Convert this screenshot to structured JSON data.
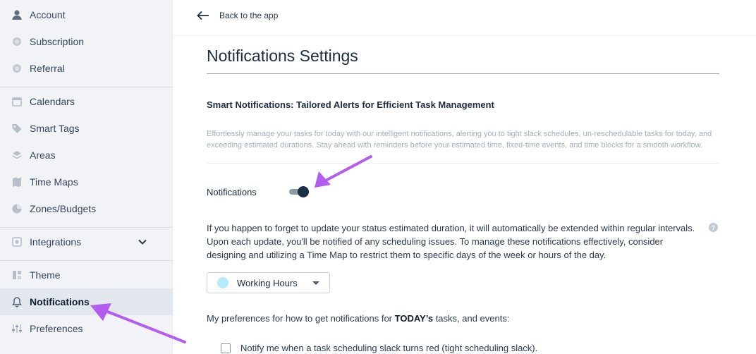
{
  "sidebar": {
    "items": [
      {
        "label": "Account",
        "icon": "user-icon"
      },
      {
        "label": "Subscription",
        "icon": "gear-icon"
      },
      {
        "label": "Referral",
        "icon": "gear-icon"
      },
      {
        "label": "Calendars",
        "icon": "calendar-icon"
      },
      {
        "label": "Smart Tags",
        "icon": "tag-icon"
      },
      {
        "label": "Areas",
        "icon": "layers-icon"
      },
      {
        "label": "Time Maps",
        "icon": "map-icon"
      },
      {
        "label": "Zones/Budgets",
        "icon": "pie-chart-icon"
      },
      {
        "label": "Integrations",
        "icon": "integration-icon"
      },
      {
        "label": "Theme",
        "icon": "theme-icon"
      },
      {
        "label": "Notifications",
        "icon": "bell-icon",
        "active": true
      },
      {
        "label": "Preferences",
        "icon": "sliders-icon"
      }
    ]
  },
  "topbar": {
    "back_label": "Back to the app"
  },
  "main": {
    "title": "Notifications Settings",
    "section_title": "Smart Notifications: Tailored Alerts for Efficient Task Management",
    "section_desc": "Effortlessly manage your tasks for today with our intelligent notifications, alerting you to tight slack schedules, un-reschedulable tasks for today, and exceeding estimated durations. Stay ahead with reminders before your estimated time, fixed-time events, and time blocks for a smooth workflow.",
    "notifications_label": "Notifications",
    "notifications_enabled": true,
    "paragraph": "If you happen to forget to update your status estimated duration, it will automatically be extended within regular intervals. Upon each update, you'll be notified of any scheduling issues. To manage these notifications effectively, consider designing and utilizing a Time Map to restrict them to specific days of the week or hours of the day.",
    "time_map_select": {
      "value": "Working Hours",
      "dot_color": "#b5ebfb"
    },
    "preferences_prefix": "My preferences for how to get notifications for ",
    "preferences_bold": "TODAY’s",
    "preferences_suffix": " tasks, and events:",
    "checkbox_label": "Notify me when a task scheduling slack turns red (tight scheduling slack)."
  },
  "colors": {
    "accent_arrow": "#b25cf0",
    "toggle_knob": "#1b2f45"
  }
}
